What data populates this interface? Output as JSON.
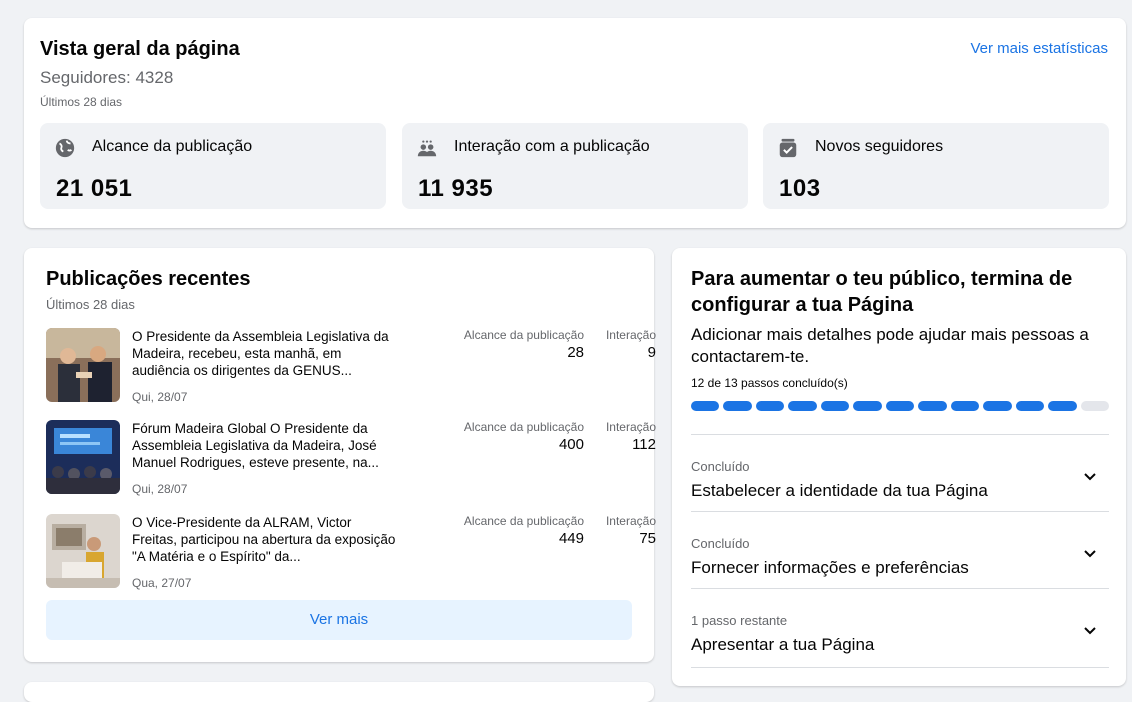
{
  "overview": {
    "title": "Vista geral da página",
    "followers": "Seguidores: 4328",
    "period": "Últimos 28 dias",
    "link": "Ver mais estatísticas",
    "metrics": [
      {
        "label": "Alcance da publicação",
        "value": "21 051",
        "icon": "globe-icon"
      },
      {
        "label": "Interação com a publicação",
        "value": "11 935",
        "icon": "people-icon"
      },
      {
        "label": "Novos seguidores",
        "value": "103",
        "icon": "follower-check-icon"
      }
    ]
  },
  "posts": {
    "title": "Publicações recentes",
    "period": "Últimos 28 dias",
    "col_reach": "Alcance da publicação",
    "col_interaction": "Interação",
    "items": [
      {
        "text": "O Presidente da Assembleia Legislativa da Madeira, recebeu, esta manhã, em audiência os dirigentes da GENUS...",
        "date": "Qui, 28/07",
        "reach": "28",
        "interaction": "9"
      },
      {
        "text": "Fórum Madeira Global O Presidente da Assembleia Legislativa da Madeira, José Manuel Rodrigues, esteve presente, na...",
        "date": "Qui, 28/07",
        "reach": "400",
        "interaction": "112"
      },
      {
        "text": "O Vice-Presidente da ALRAM, Victor Freitas, participou na abertura da exposição \"A Matéria e o Espírito\" da...",
        "date": "Qua, 27/07",
        "reach": "449",
        "interaction": "75"
      }
    ],
    "more": "Ver mais"
  },
  "setup": {
    "title": "Para aumentar o teu público, termina de configurar a tua Página",
    "description": "Adicionar mais detalhes pode ajudar mais pessoas a contactarem-te.",
    "progress_label": "12 de 13 passos concluído(s)",
    "progress_done": 12,
    "progress_total": 13,
    "steps": [
      {
        "status": "Concluído",
        "title": "Estabelecer a identidade da tua Página"
      },
      {
        "status": "Concluído",
        "title": "Fornecer informações e preferências"
      },
      {
        "status": "1 passo restante",
        "title": "Apresentar a tua Página"
      }
    ]
  },
  "colors": {
    "accent": "#1b74e4",
    "background": "#f0f2f5",
    "muted_text": "#65676b"
  }
}
